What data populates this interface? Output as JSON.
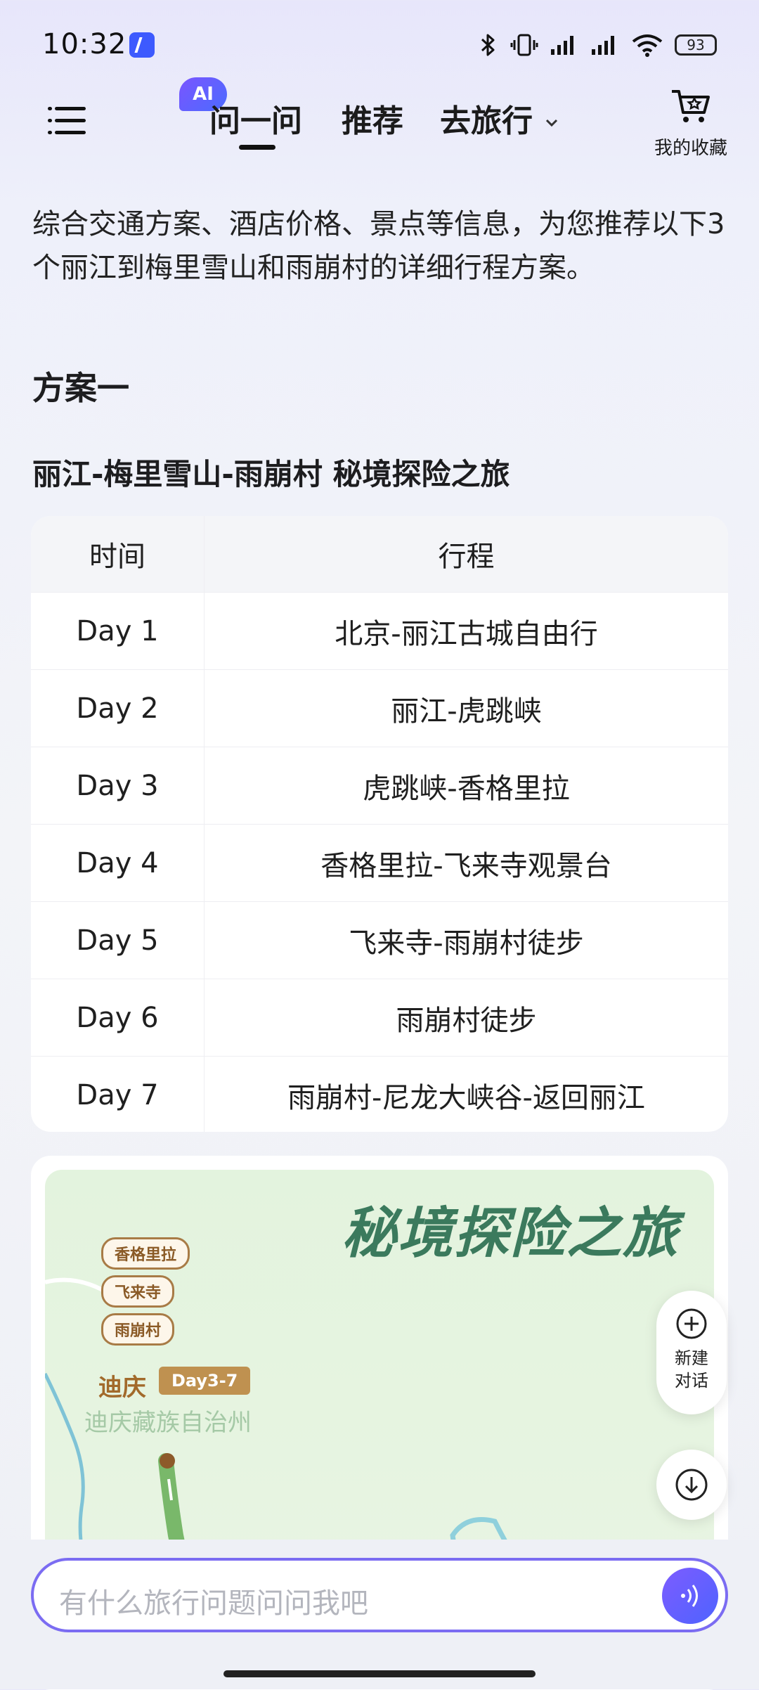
{
  "status": {
    "time": "10:32",
    "battery": "93"
  },
  "header": {
    "tabs": [
      {
        "label": "问一问",
        "active": true
      },
      {
        "label": "推荐"
      },
      {
        "label": "去旅行"
      }
    ],
    "ai_badge": "AI",
    "favorites_label": "我的收藏"
  },
  "content": {
    "intro": "综合交通方案、酒店价格、景点等信息，为您推荐以下3个丽江到梅里雪山和雨崩村的详细行程方案。",
    "plan_title": "方案一",
    "route_title": "丽江-梅里雪山-雨崩村 秘境探险之旅",
    "table": {
      "headers": [
        "时间",
        "行程"
      ],
      "rows": [
        {
          "day": "Day 1",
          "route": "北京-丽江古城自由行"
        },
        {
          "day": "Day 2",
          "route": "丽江-虎跳峡"
        },
        {
          "day": "Day 3",
          "route": "虎跳峡-香格里拉"
        },
        {
          "day": "Day 4",
          "route": "香格里拉-飞来寺观景台"
        },
        {
          "day": "Day 5",
          "route": "飞来寺-雨崩村徒步"
        },
        {
          "day": "Day 6",
          "route": "雨崩村徒步"
        },
        {
          "day": "Day 7",
          "route": "雨崩村-尼龙大峡谷-返回丽江"
        }
      ]
    },
    "map": {
      "title": "秘境探险之旅",
      "tags": [
        "香格里拉",
        "飞来寺",
        "雨崩村"
      ],
      "city": "迪庆",
      "day_tag": "Day3-7",
      "region": "迪庆藏族自治州"
    }
  },
  "floating": {
    "new_chat": [
      "新建",
      "对话"
    ]
  },
  "input": {
    "placeholder": "有什么旅行问题问问我吧"
  },
  "colors": {
    "accent": "#6c5cf5",
    "map_green": "#3b7a5d",
    "tag_brown": "#a87b46"
  }
}
